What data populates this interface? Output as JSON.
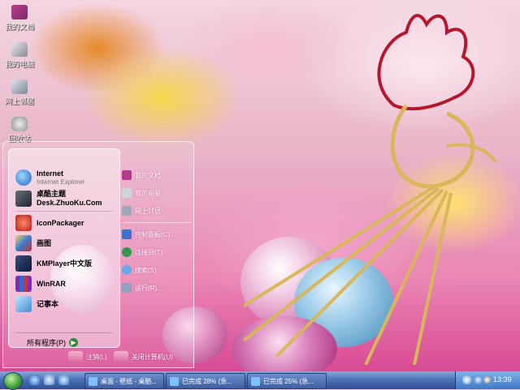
{
  "desktop_icons": [
    {
      "label": "我的文档",
      "icon": "my-documents-icon"
    },
    {
      "label": "我的电脑",
      "icon": "my-computer-icon"
    },
    {
      "label": "网上邻居",
      "icon": "network-places-icon"
    },
    {
      "label": "回收站",
      "icon": "recycle-bin-icon"
    }
  ],
  "start_menu": {
    "pinned": [
      {
        "label": "Internet",
        "sub": "Internet Explorer",
        "icon": "internet-explorer-icon"
      },
      {
        "label": "桌酷主题",
        "sub": "Desk.ZhuoKu.Com",
        "icon": "zhuoku-icon"
      }
    ],
    "recent": [
      {
        "label": "IconPackager",
        "icon": "iconpackager-icon"
      },
      {
        "label": "画图",
        "icon": "paint-icon"
      },
      {
        "label": "KMPlayer中文版",
        "icon": "kmplayer-icon"
      },
      {
        "label": "WinRAR",
        "icon": "winrar-icon"
      },
      {
        "label": "记事本",
        "icon": "notepad-icon"
      }
    ],
    "all_programs": "所有程序(P)",
    "right_column": [
      {
        "label": "我的文档",
        "icon": "my-documents-icon"
      },
      {
        "label": "我的电脑",
        "icon": "my-computer-icon"
      },
      {
        "label": "网上邻居",
        "icon": "network-places-icon"
      },
      {
        "label": "控制面板(C)",
        "icon": "control-panel-icon"
      },
      {
        "label": "连接到(T)",
        "icon": "connect-to-icon"
      },
      {
        "label": "搜索(S)",
        "icon": "search-icon"
      },
      {
        "label": "运行(R)...",
        "icon": "run-icon"
      }
    ],
    "logoff_label": "注销(L)",
    "shutdown_label": "关闭计算机(U)"
  },
  "taskbar": {
    "tasks": [
      {
        "label": "桌面 - 壁纸 - 桌酷...",
        "icon": "ie-window-icon"
      },
      {
        "label": "已完成 28% (急...",
        "icon": "ie-download-icon"
      },
      {
        "label": "已完成 25% (急...",
        "icon": "ie-download-icon"
      }
    ],
    "clock": "13:39"
  }
}
